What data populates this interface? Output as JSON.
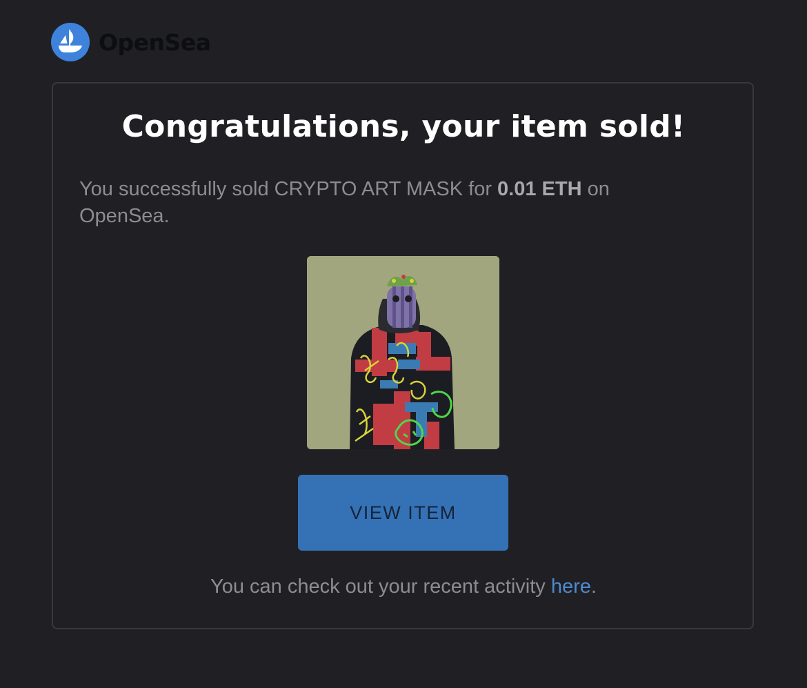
{
  "brand": {
    "name": "OpenSea",
    "icon": "opensea-boat-icon",
    "color": "#3e82dc"
  },
  "email": {
    "title": "Congratulations, your item sold!",
    "message_prefix": "You successfully sold CRYPTO ART MASK for ",
    "price": "0.01 ETH",
    "message_suffix": " on OpenSea.",
    "item_image": "nft-artwork-masked-figure",
    "button_label": "VIEW ITEM",
    "footer_prefix": "You can check out your recent activity ",
    "footer_link": "here",
    "footer_suffix": "."
  },
  "colors": {
    "background": "#202024",
    "button": "#3472b5",
    "link": "#4d8ad0"
  }
}
